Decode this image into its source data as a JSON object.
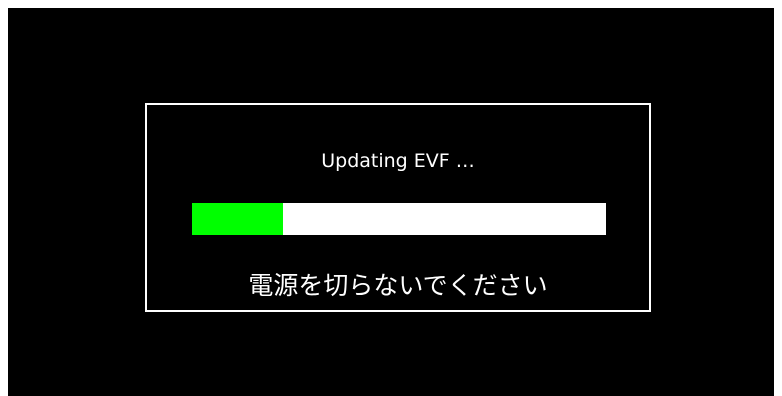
{
  "dialog": {
    "status_text": "Updating EVF …",
    "warning_text": "電源を切らないでください"
  },
  "progress": {
    "fraction": 0.22,
    "fill_color": "#00ff00",
    "track_color": "#ffffff"
  },
  "colors": {
    "background": "#000000",
    "foreground": "#ffffff"
  }
}
